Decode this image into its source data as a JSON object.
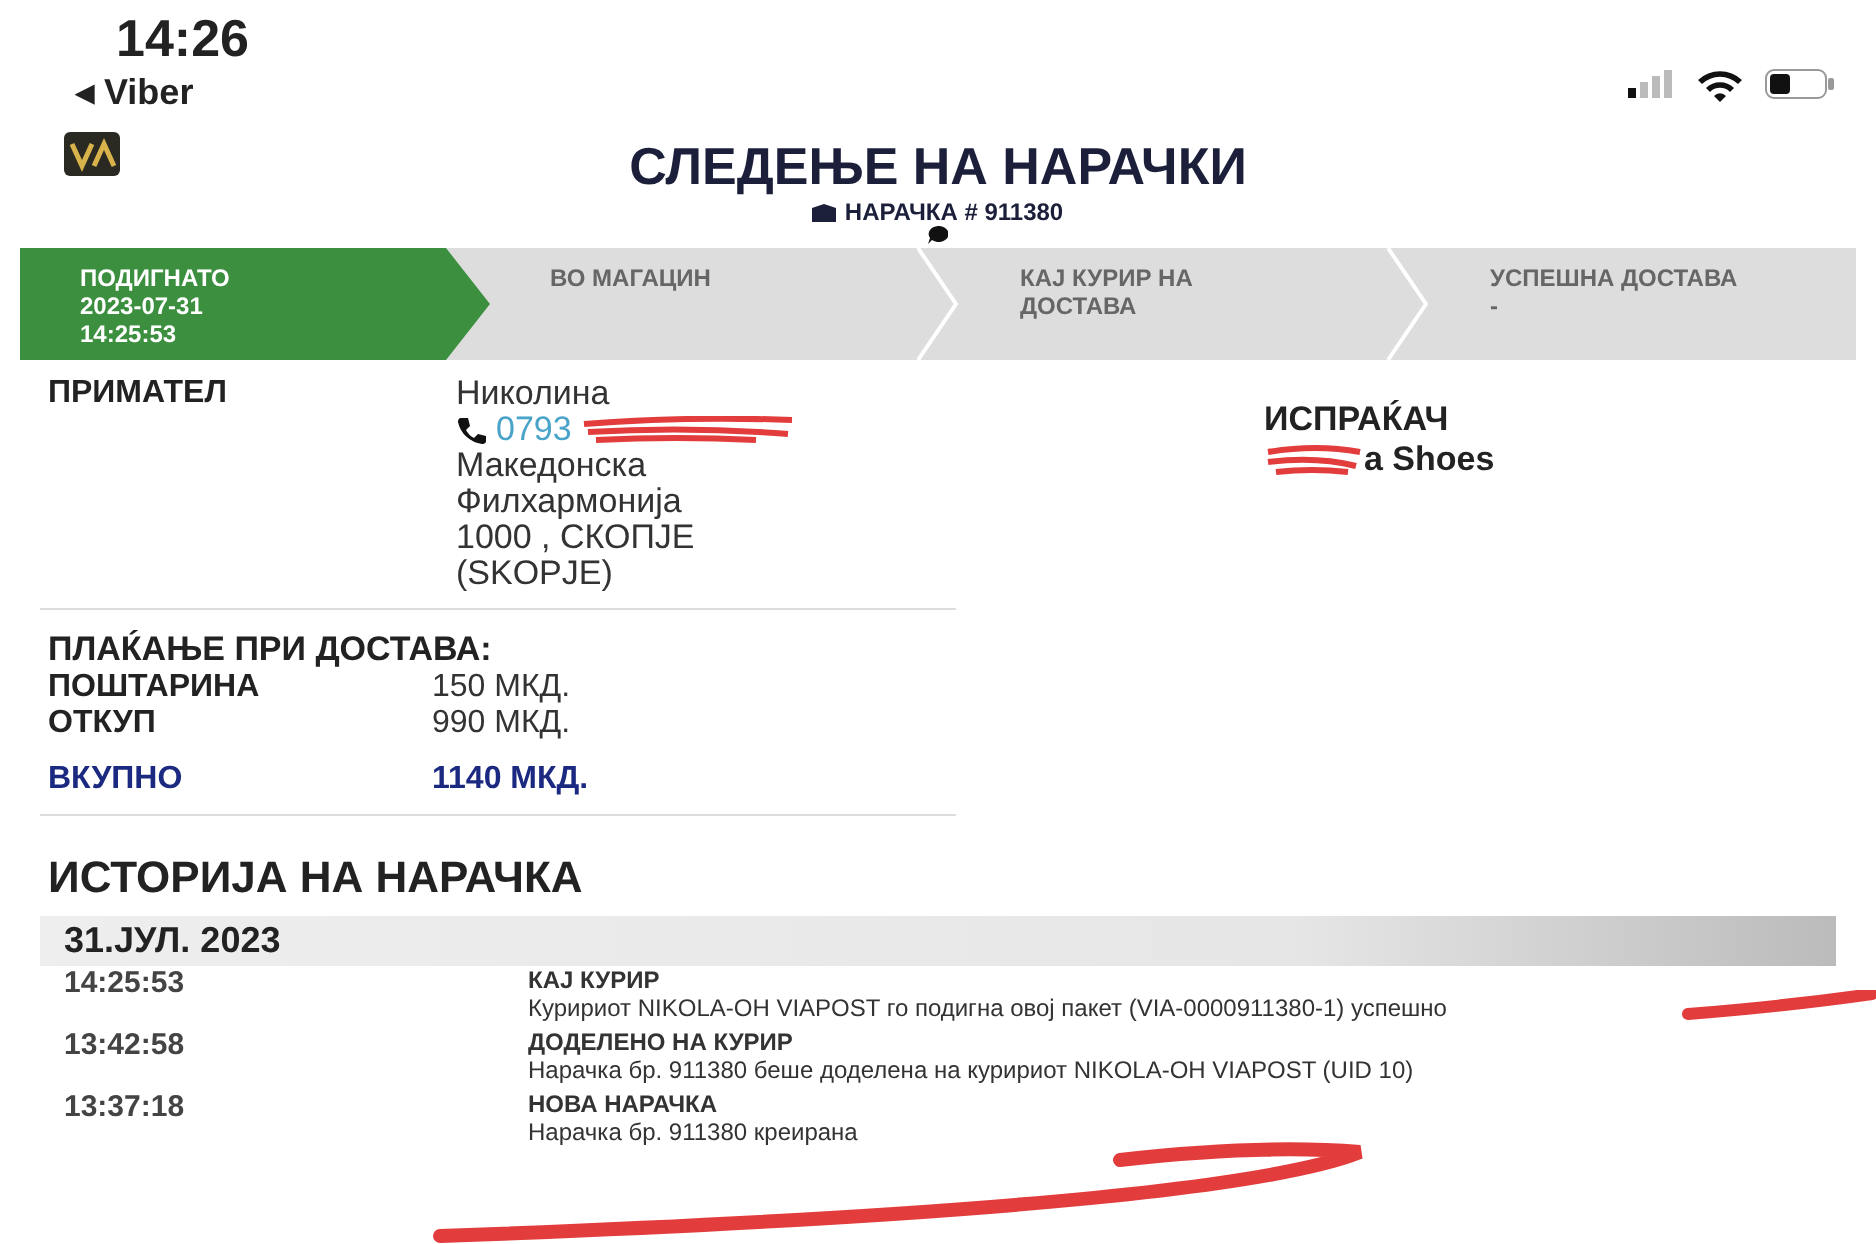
{
  "status_bar": {
    "time": "14:26",
    "back_app": "◂ Viber"
  },
  "header": {
    "title": "СЛЕДЕЊЕ НА НАРАЧКИ",
    "order": "НАРАЧКА # 911380"
  },
  "steps": [
    {
      "label": "ПОДИГНАТО",
      "details": [
        "2023-07-31",
        "14:25:53"
      ],
      "done": true
    },
    {
      "label": "ВО МАГАЦИН",
      "done": false
    },
    {
      "label": "КАЈ КУРИР НА ДОСТАВА",
      "done": false
    },
    {
      "label": "УСПЕШНА ДОСТАВА",
      "details": [
        "-"
      ],
      "done": false
    }
  ],
  "recipient": {
    "label": "ПРИМАТЕЛ",
    "name": "Николина",
    "phone": "0793",
    "address": [
      "Македонска",
      "Филхармонија",
      "1000 , СКОПЈЕ",
      "(SKOPJE)"
    ]
  },
  "sender": {
    "label": "ИСПРАЌАЧ",
    "name": "a Shoes"
  },
  "payment": {
    "heading": "ПЛАЌАЊЕ ПРИ ДОСТАВА:",
    "rows": [
      {
        "label": "ПОШТАРИНА",
        "value": "150 МКД."
      },
      {
        "label": "ОТКУП",
        "value": "990 МКД."
      }
    ],
    "total_label": "ВКУПНО",
    "total_value": "1140 МКД."
  },
  "history": {
    "heading": "ИСТОРИЈА НА НАРАЧКА",
    "date": "31.ЈУЛ. 2023",
    "events": [
      {
        "time": "14:25:53",
        "title": "КАЈ КУРИР",
        "text": "Куририот NIKOLA-OH VIAPOST го подигна овој пакет (VIA-0000911380-1) успешно"
      },
      {
        "time": "13:42:58",
        "title": "ДОДЕЛЕНО НА КУРИР",
        "text": "Нарачка бр. 911380 беше доделена на куририот NIKOLA-OH VIAPOST (UID 10)"
      },
      {
        "time": "13:37:18",
        "title": "НОВА НАРАЧКА",
        "text": "Нарачка бр. 911380 креирана"
      }
    ]
  }
}
